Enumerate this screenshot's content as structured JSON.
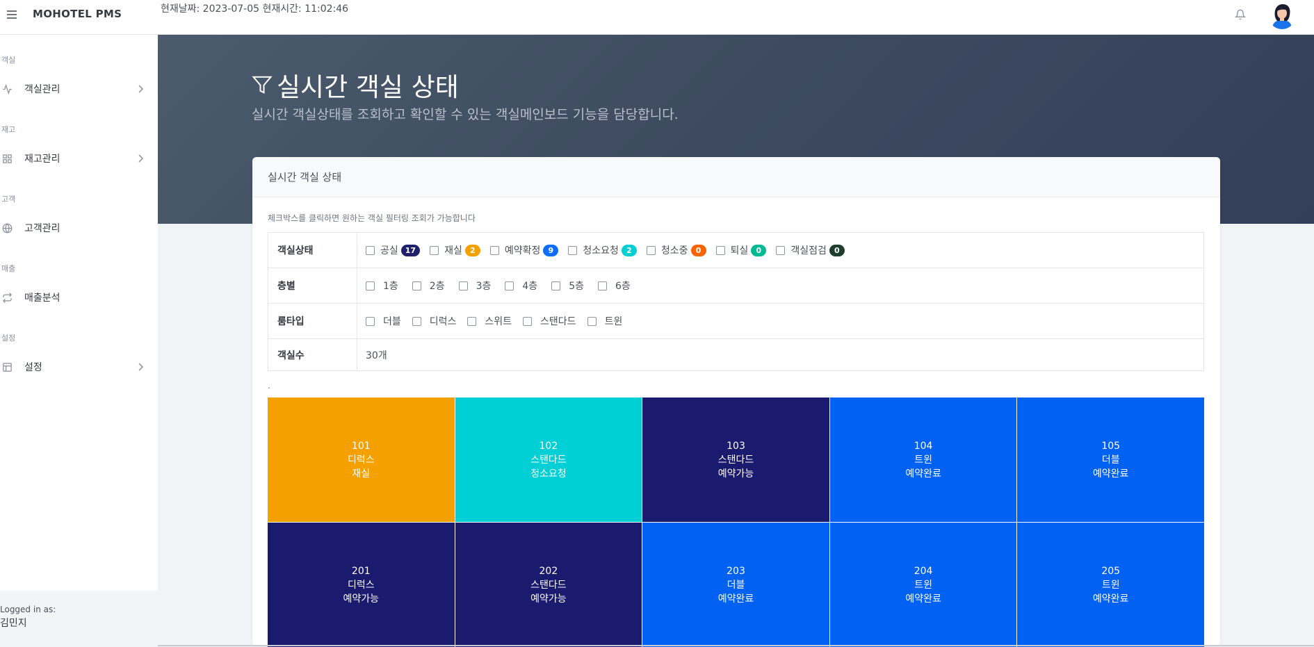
{
  "header": {
    "brand": "MOHOTEL PMS",
    "datetime": "현재날짜: 2023-07-05 현재시간: 11:02:46"
  },
  "sidebar": {
    "sections": [
      {
        "label": "객실",
        "item": "객실관리",
        "icon": "activity-icon",
        "has_chevron": true
      },
      {
        "label": "재고",
        "item": "재고관리",
        "icon": "grid-icon",
        "has_chevron": true
      },
      {
        "label": "고객",
        "item": "고객관리",
        "icon": "globe-icon",
        "has_chevron": false
      },
      {
        "label": "매출",
        "item": "매출분석",
        "icon": "repeat-icon",
        "has_chevron": false
      },
      {
        "label": "설정",
        "item": "설정",
        "icon": "layout-icon",
        "has_chevron": true
      }
    ],
    "logged_in_label": "Logged in as:",
    "user_name": "김민지"
  },
  "hero": {
    "title": "실시간 객실 상태",
    "subtitle": "실시간 객실상태를 조회하고 확인할 수 있는 객실메인보드 기능을 담당합니다."
  },
  "card": {
    "title": "실시간 객실 상태",
    "hint": "체크박스를 클릭하면 원하는 객실 필터링 조회가 가능합니다",
    "dot": "."
  },
  "filters": {
    "status": {
      "label": "객실상태",
      "options": [
        {
          "label": "공실",
          "count": "17",
          "color": "#1f1f6b"
        },
        {
          "label": "재실",
          "count": "2",
          "color": "#f4a100"
        },
        {
          "label": "예약확정",
          "count": "9",
          "color": "#0d6efd"
        },
        {
          "label": "청소요청",
          "count": "2",
          "color": "#00cfd5"
        },
        {
          "label": "청소중",
          "count": "0",
          "color": "#f76400"
        },
        {
          "label": "퇴실",
          "count": "0",
          "color": "#00ba94"
        },
        {
          "label": "객실점검",
          "count": "0",
          "color": "#1d3d2f"
        }
      ]
    },
    "floor": {
      "label": "층별",
      "options": [
        "1층",
        "2층",
        "3층",
        "4층",
        "5층",
        "6층"
      ]
    },
    "roomtype": {
      "label": "룸타입",
      "options": [
        "더블",
        "디럭스",
        "스위트",
        "스탠다드",
        "트윈"
      ]
    },
    "count": {
      "label": "객실수",
      "value": "30개"
    }
  },
  "rooms": [
    {
      "number": "101",
      "type": "디럭스",
      "status": "재실",
      "color": "#f4a100"
    },
    {
      "number": "102",
      "type": "스탠다드",
      "status": "청소요청",
      "color": "#00cfd5"
    },
    {
      "number": "103",
      "type": "스탠다드",
      "status": "예약가능",
      "color": "#1a1a6e"
    },
    {
      "number": "104",
      "type": "트윈",
      "status": "예약완료",
      "color": "#0061f2"
    },
    {
      "number": "105",
      "type": "더블",
      "status": "예약완료",
      "color": "#0061f2"
    },
    {
      "number": "201",
      "type": "디럭스",
      "status": "예약가능",
      "color": "#1a1a6e"
    },
    {
      "number": "202",
      "type": "스탠다드",
      "status": "예약가능",
      "color": "#1a1a6e"
    },
    {
      "number": "203",
      "type": "더블",
      "status": "예약완료",
      "color": "#0061f2"
    },
    {
      "number": "204",
      "type": "트윈",
      "status": "예약완료",
      "color": "#0061f2"
    },
    {
      "number": "205",
      "type": "트윈",
      "status": "예약완료",
      "color": "#0061f2"
    }
  ]
}
